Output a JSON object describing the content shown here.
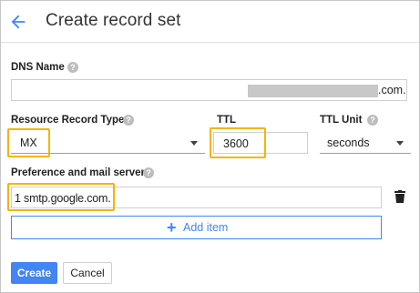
{
  "header": {
    "title": "Create record set",
    "back_icon": "arrow-back-icon"
  },
  "dns_name": {
    "label": "DNS Name",
    "suffix": ".com."
  },
  "record_type": {
    "label": "Resource Record Type",
    "value": "MX"
  },
  "ttl": {
    "label": "TTL",
    "value": "3600"
  },
  "ttl_unit": {
    "label": "TTL Unit",
    "value": "seconds"
  },
  "mail_server": {
    "label": "Preference and mail server",
    "value": "1 smtp.google.com."
  },
  "add_item": {
    "label": "Add item"
  },
  "actions": {
    "create_label": "Create",
    "cancel_label": "Cancel"
  },
  "colors": {
    "accent": "#4285f4",
    "highlight": "#f4b400"
  }
}
